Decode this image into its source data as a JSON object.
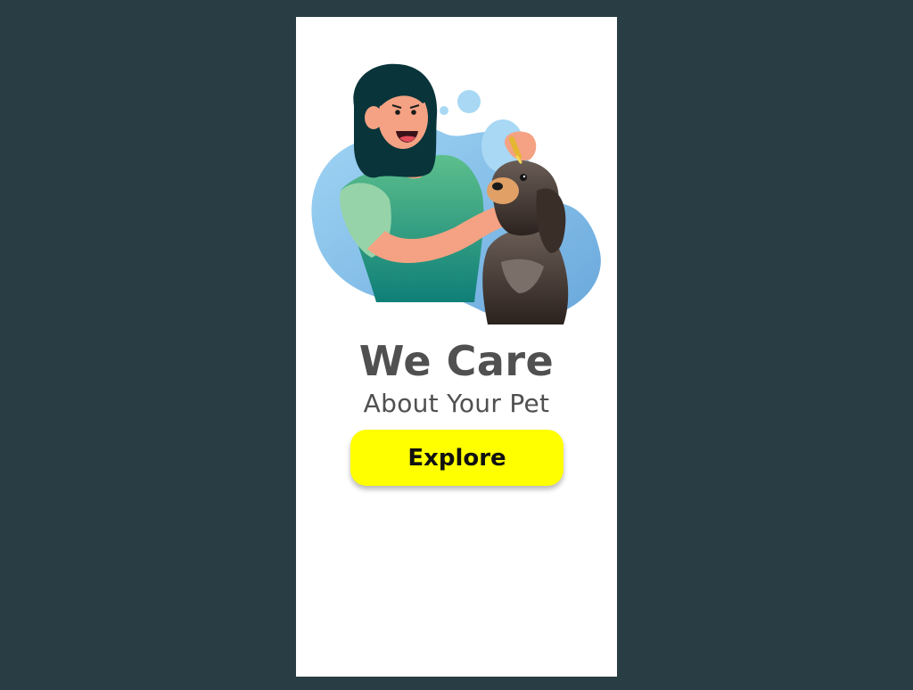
{
  "hero": {
    "title": "We Care",
    "subtitle": "About Your Pet",
    "illustration_icon": "woman-with-dog-illustration"
  },
  "actions": {
    "explore_label": "Explore"
  },
  "colors": {
    "page_background": "#283e44",
    "card_background": "#ffffff",
    "text": "#505050",
    "button": "#ffff00",
    "blob_blue": "#8cc4ec"
  }
}
